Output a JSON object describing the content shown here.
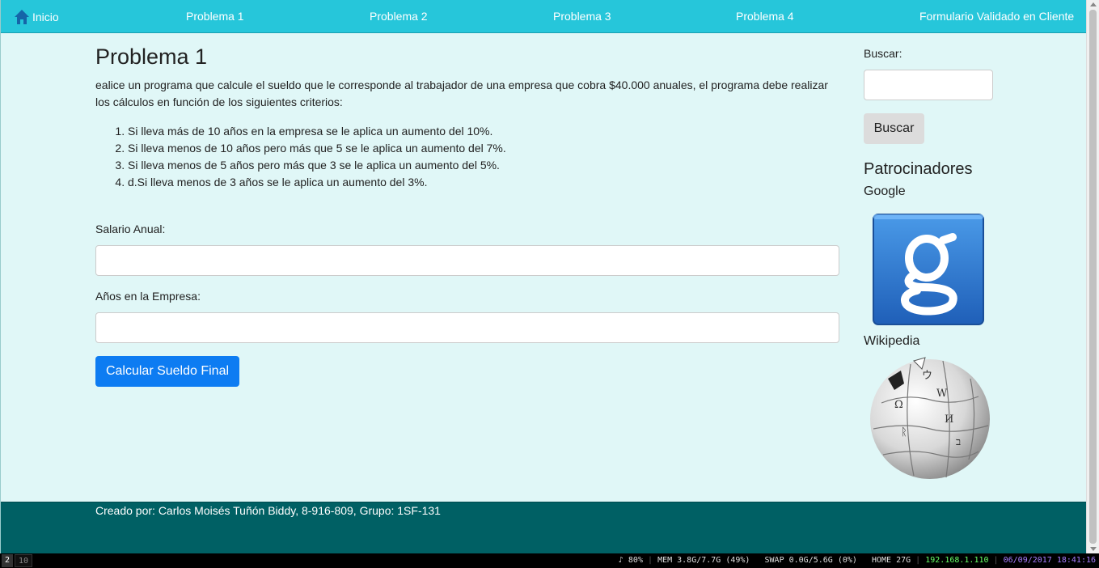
{
  "nav": {
    "home": "Inicio",
    "items": [
      "Problema 1",
      "Problema 2",
      "Problema 3",
      "Problema 4",
      "Formulario Validado en Cliente"
    ]
  },
  "main": {
    "title": "Problema 1",
    "description": "ealice un programa que calcule el sueldo que le corresponde al trabajador de una empresa que cobra $40.000 anuales, el programa debe realizar los cálculos en función de los siguientes criterios:",
    "criteria": [
      "Si lleva más de 10 años en la empresa se le aplica un aumento del 10%.",
      "Si lleva menos de 10 años pero más que 5 se le aplica un aumento del 7%.",
      "Si lleva menos de 5 años pero más que 3 se le aplica un aumento del 5%.",
      "d.Si lleva menos de 3 años se le aplica un aumento del 3%."
    ],
    "salary_label": "Salario Anual:",
    "salary_value": "",
    "years_label": "Años en la Empresa:",
    "years_value": "",
    "submit_label": "Calcular Sueldo Final"
  },
  "sidebar": {
    "search_label": "Buscar:",
    "search_value": "",
    "search_button": "Buscar",
    "sponsors_title": "Patrocinadores",
    "sponsors": [
      {
        "name": "Google",
        "icon": "google-logo-icon"
      },
      {
        "name": "Wikipedia",
        "icon": "wikipedia-globe-icon"
      }
    ]
  },
  "footer": {
    "text": "Creado por: Carlos Moisés Tuñón Biddy, 8-916-809, Grupo: 1SF-131"
  },
  "statusbar": {
    "workspaces": [
      "2",
      "10"
    ],
    "volume": "♪ 80%",
    "mem": "MEM 3.8G/7.7G (49%)",
    "swap": "SWAP 0.0G/5.6G (0%)",
    "home": "HOME 27G",
    "ip": "192.168.1.110",
    "datetime": "06/09/2017 18:41:16"
  },
  "colors": {
    "navbar": "#26c6da",
    "page_bg": "#e0f7f7",
    "primary_button": "#0d7cf2",
    "footer": "#006064"
  }
}
